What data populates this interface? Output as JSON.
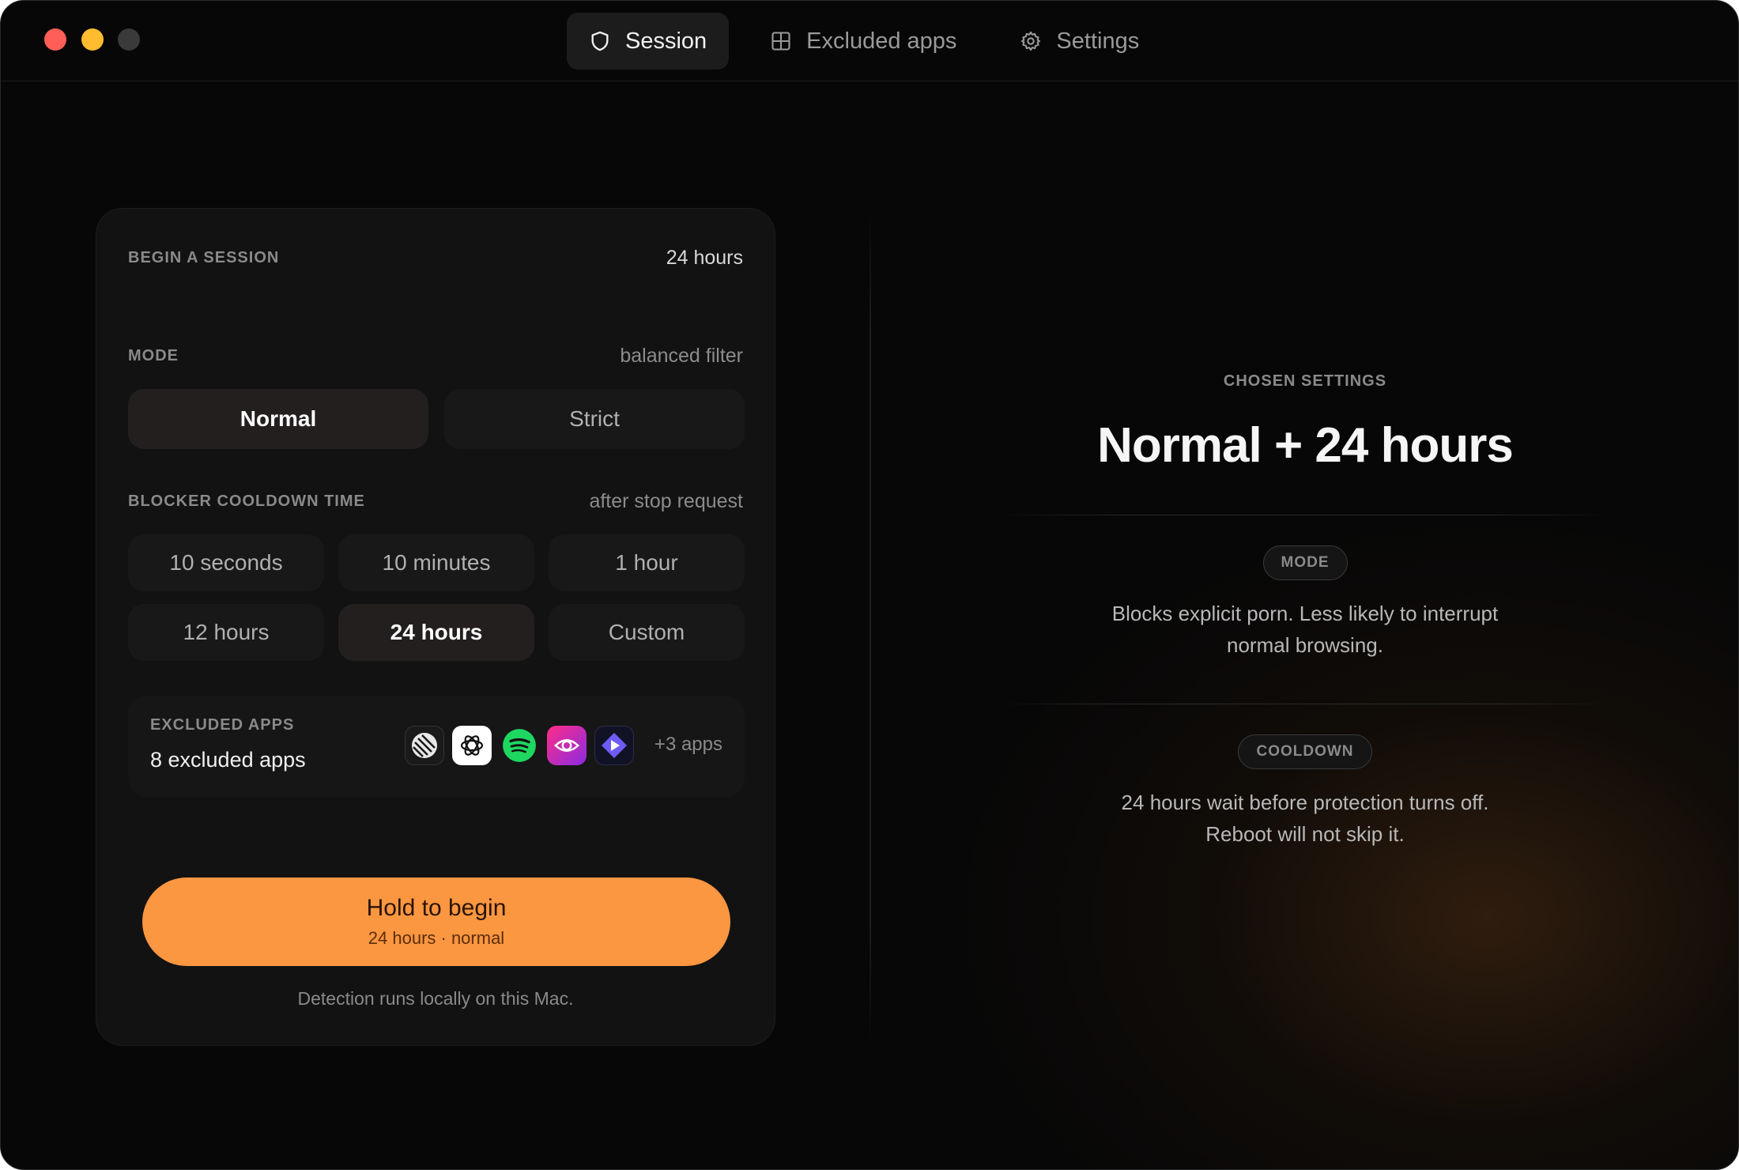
{
  "window": {
    "traffic_lights": [
      "close",
      "minimize",
      "maximize"
    ]
  },
  "tabs": [
    {
      "label": "Session",
      "icon": "shield-icon",
      "active": true
    },
    {
      "label": "Excluded apps",
      "icon": "grid-icon",
      "active": false
    },
    {
      "label": "Settings",
      "icon": "gear-icon",
      "active": false
    }
  ],
  "session_card": {
    "title": "BEGIN A SESSION",
    "duration": "24 hours",
    "mode": {
      "label": "MODE",
      "hint": "balanced filter",
      "options": [
        "Normal",
        "Strict"
      ],
      "selected": "Normal"
    },
    "cooldown": {
      "label": "BLOCKER COOLDOWN TIME",
      "hint": "after stop request",
      "options": [
        "10 seconds",
        "10 minutes",
        "1 hour",
        "12 hours",
        "24 hours",
        "Custom"
      ],
      "selected": "24 hours"
    },
    "excluded": {
      "label": "EXCLUDED APPS",
      "count_text": "8 excluded apps",
      "more_text": "+3 apps",
      "icons": [
        "linear-app-icon",
        "chatgpt-app-icon",
        "spotify-app-icon",
        "eye-app-icon",
        "play-app-icon"
      ]
    },
    "hold_button": {
      "label": "Hold to begin",
      "sub": "24 hours · normal"
    },
    "footnote": "Detection runs locally on this Mac."
  },
  "summary": {
    "label": "CHOSEN SETTINGS",
    "title": "Normal + 24 hours",
    "mode_pill": "MODE",
    "mode_desc": "Blocks explicit porn. Less likely to interrupt normal browsing.",
    "cooldown_pill": "COOLDOWN",
    "cooldown_desc": "24 hours wait before protection turns off. Reboot will not skip it."
  },
  "colors": {
    "accent": "#fb9641",
    "background": "#070707",
    "card": "#121212"
  }
}
